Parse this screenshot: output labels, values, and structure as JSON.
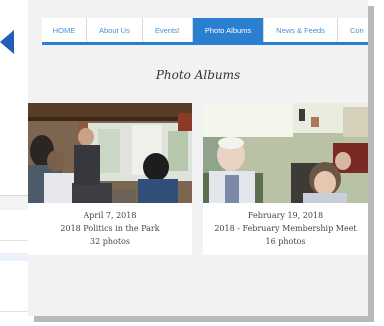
{
  "nav": {
    "items": [
      {
        "label": "HOME"
      },
      {
        "label": "About Us"
      },
      {
        "label": "Events!"
      },
      {
        "label": "Photo Albums",
        "active": true
      },
      {
        "label": "News & Feeds"
      },
      {
        "label": "Con"
      }
    ]
  },
  "page": {
    "title": "Photo Albums"
  },
  "albums": [
    {
      "date": "April 7, 2018",
      "title": "2018 Politics in the Park",
      "count": "32 photos"
    },
    {
      "date": "February 19, 2018",
      "title": "2018 - February Membership Meet",
      "count": "16 photos"
    }
  ],
  "colors": {
    "accent": "#2a7fd1",
    "nav_text": "#4a90d9",
    "panel_bg": "#f2f2f2"
  }
}
